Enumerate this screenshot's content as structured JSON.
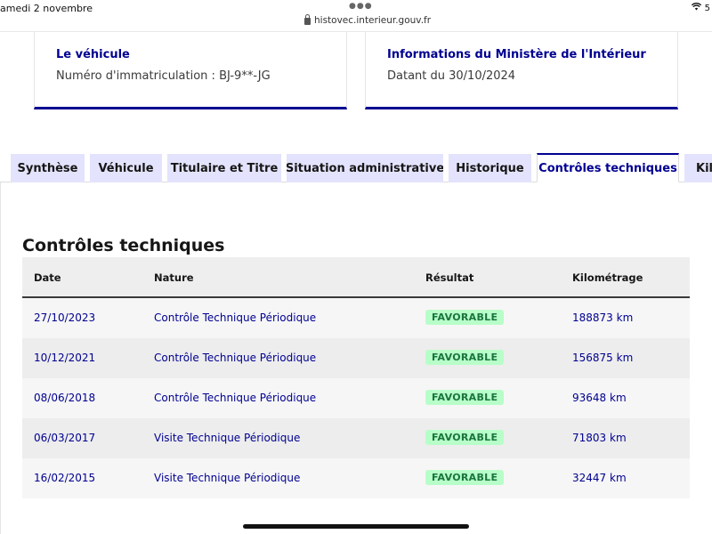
{
  "status_bar": {
    "time_text": "amedi 2 novembre",
    "url": "histovec.interieur.gouv.fr",
    "battery_partial": "5"
  },
  "cards": {
    "vehicle": {
      "title": "Le véhicule",
      "text": "Numéro d'immatriculation : BJ-9**-JG"
    },
    "ministry": {
      "title": "Informations du Ministère de l'Intérieur",
      "text": "Datant du 30/10/2024"
    }
  },
  "tabs": [
    {
      "label": "Synthèse"
    },
    {
      "label": "Véhicule"
    },
    {
      "label": "Titulaire et Titre"
    },
    {
      "label": "Situation administrative"
    },
    {
      "label": "Historique"
    },
    {
      "label": "Contrôles techniques",
      "active": true
    },
    {
      "label": "Kilo"
    }
  ],
  "section": {
    "title": "Contrôles techniques"
  },
  "table": {
    "headers": {
      "date": "Date",
      "nature": "Nature",
      "result": "Résultat",
      "km": "Kilométrage"
    },
    "rows": [
      {
        "date": "27/10/2023",
        "nature": "Contrôle Technique Périodique",
        "result": "FAVORABLE",
        "km": "188873 km"
      },
      {
        "date": "10/12/2021",
        "nature": "Contrôle Technique Périodique",
        "result": "FAVORABLE",
        "km": "156875 km"
      },
      {
        "date": "08/06/2018",
        "nature": "Contrôle Technique Périodique",
        "result": "FAVORABLE",
        "km": "93648 km"
      },
      {
        "date": "06/03/2017",
        "nature": "Visite Technique Périodique",
        "result": "FAVORABLE",
        "km": "71803 km"
      },
      {
        "date": "16/02/2015",
        "nature": "Visite Technique Périodique",
        "result": "FAVORABLE",
        "km": "32447 km"
      }
    ]
  },
  "colors": {
    "brand_blue": "#000091",
    "tab_bg": "#e3e3fd",
    "badge_bg": "#b8fec9",
    "badge_text": "#18753c"
  }
}
